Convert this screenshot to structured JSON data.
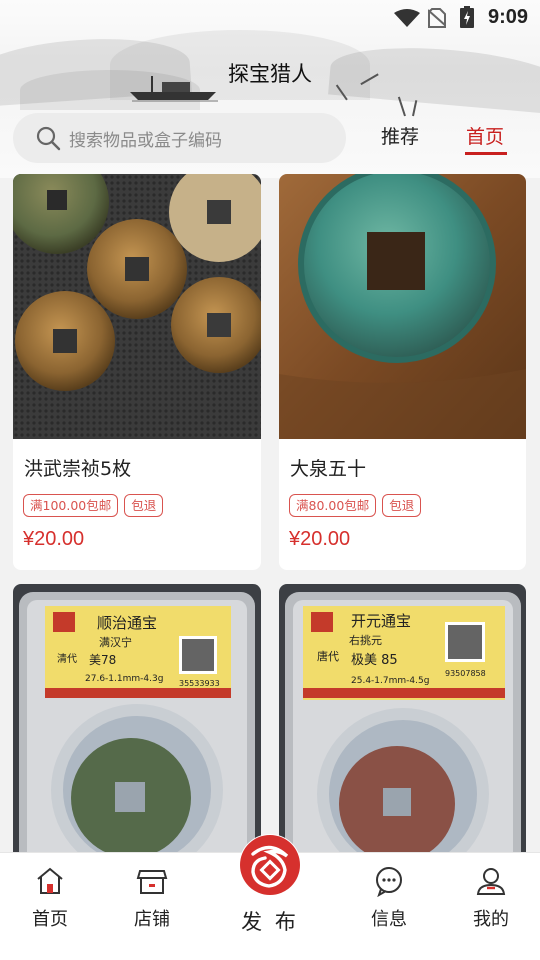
{
  "status_bar": {
    "time": "9:09"
  },
  "header": {
    "app_title": "探宝猎人"
  },
  "search": {
    "placeholder": "搜索物品或盒子编码"
  },
  "tabs": [
    {
      "label": "推荐",
      "active": false
    },
    {
      "label": "首页",
      "active": true
    }
  ],
  "products": [
    {
      "name": "洪武崇祯5枚",
      "tags": [
        "满100.00包邮",
        "包退"
      ],
      "price": "¥20.00"
    },
    {
      "name": "大泉五十",
      "tags": [
        "满80.00包邮",
        "包退"
      ],
      "price": "¥20.00"
    },
    {
      "name": "",
      "graded_label": {
        "title": "顺治通宝",
        "subtitle": "满汉宁",
        "era": "清代",
        "grade": "美78",
        "spec": "27.6-1.1mm-4.3g",
        "code": "35533933"
      }
    },
    {
      "name": "",
      "graded_label": {
        "title": "开元通宝",
        "subtitle": "右挑元",
        "era": "唐代",
        "grade": "极美 85",
        "spec": "25.4-1.7mm-4.5g",
        "code": "93507858"
      }
    }
  ],
  "bottom_nav": [
    {
      "label": "首页",
      "icon": "home-icon"
    },
    {
      "label": "店铺",
      "icon": "shop-icon"
    },
    {
      "label": "发 布",
      "icon": "publish-icon"
    },
    {
      "label": "信息",
      "icon": "message-icon"
    },
    {
      "label": "我的",
      "icon": "profile-icon"
    }
  ],
  "colors": {
    "accent": "#c8201f",
    "price": "#d6302d",
    "tag_border": "#d9534f"
  }
}
